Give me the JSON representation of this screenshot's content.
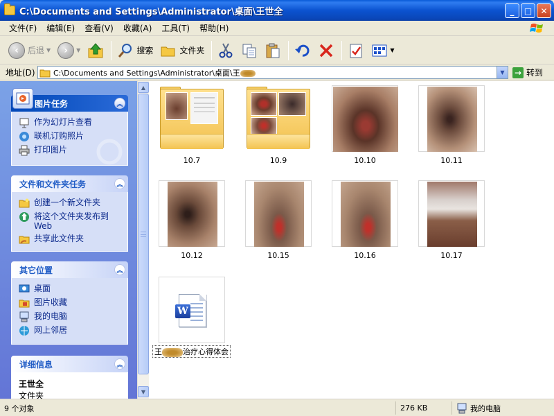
{
  "window": {
    "title": "C:\\Documents and Settings\\Administrator\\桌面\\王世全",
    "minimize": "_",
    "maximize": "□",
    "close": "✕"
  },
  "menu": [
    "文件(F)",
    "编辑(E)",
    "查看(V)",
    "收藏(A)",
    "工具(T)",
    "帮助(H)"
  ],
  "toolbar": {
    "back": "后退",
    "search": "搜索",
    "folders": "文件夹"
  },
  "address": {
    "label": "地址(D)",
    "path": "C:\\Documents and Settings\\Administrator\\桌面\\王",
    "go": "转到"
  },
  "panels": {
    "picture_tasks": {
      "title": "图片任务",
      "items": [
        "作为幻灯片查看",
        "联机订购照片",
        "打印图片"
      ]
    },
    "file_tasks": {
      "title": "文件和文件夹任务",
      "items": [
        "创建一个新文件夹",
        "将这个文件夹发布到 Web",
        "共享此文件夹"
      ]
    },
    "other_places": {
      "title": "其它位置",
      "items": [
        "桌面",
        "图片收藏",
        "我的电脑",
        "网上邻居"
      ]
    },
    "details": {
      "title": "详细信息",
      "name": "王世全",
      "type": "文件夹"
    }
  },
  "items": [
    {
      "label": "10.7",
      "kind": "folder"
    },
    {
      "label": "10.9",
      "kind": "folder"
    },
    {
      "label": "10.10",
      "kind": "photo"
    },
    {
      "label": "10.11",
      "kind": "photo"
    },
    {
      "label": "10.12",
      "kind": "photo"
    },
    {
      "label": "10.15",
      "kind": "photo"
    },
    {
      "label": "10.16",
      "kind": "photo"
    },
    {
      "label": "10.17",
      "kind": "photo"
    }
  ],
  "doc_file": {
    "label_prefix": "王",
    "label_suffix": "治疗心得体会"
  },
  "status": {
    "count": "9 个对象",
    "size": "276 KB",
    "location": "我的电脑"
  },
  "colors": {
    "titlebar": "#0a5bd8",
    "taskpane": "#7ba2e7",
    "link": "#0c2a8c"
  }
}
